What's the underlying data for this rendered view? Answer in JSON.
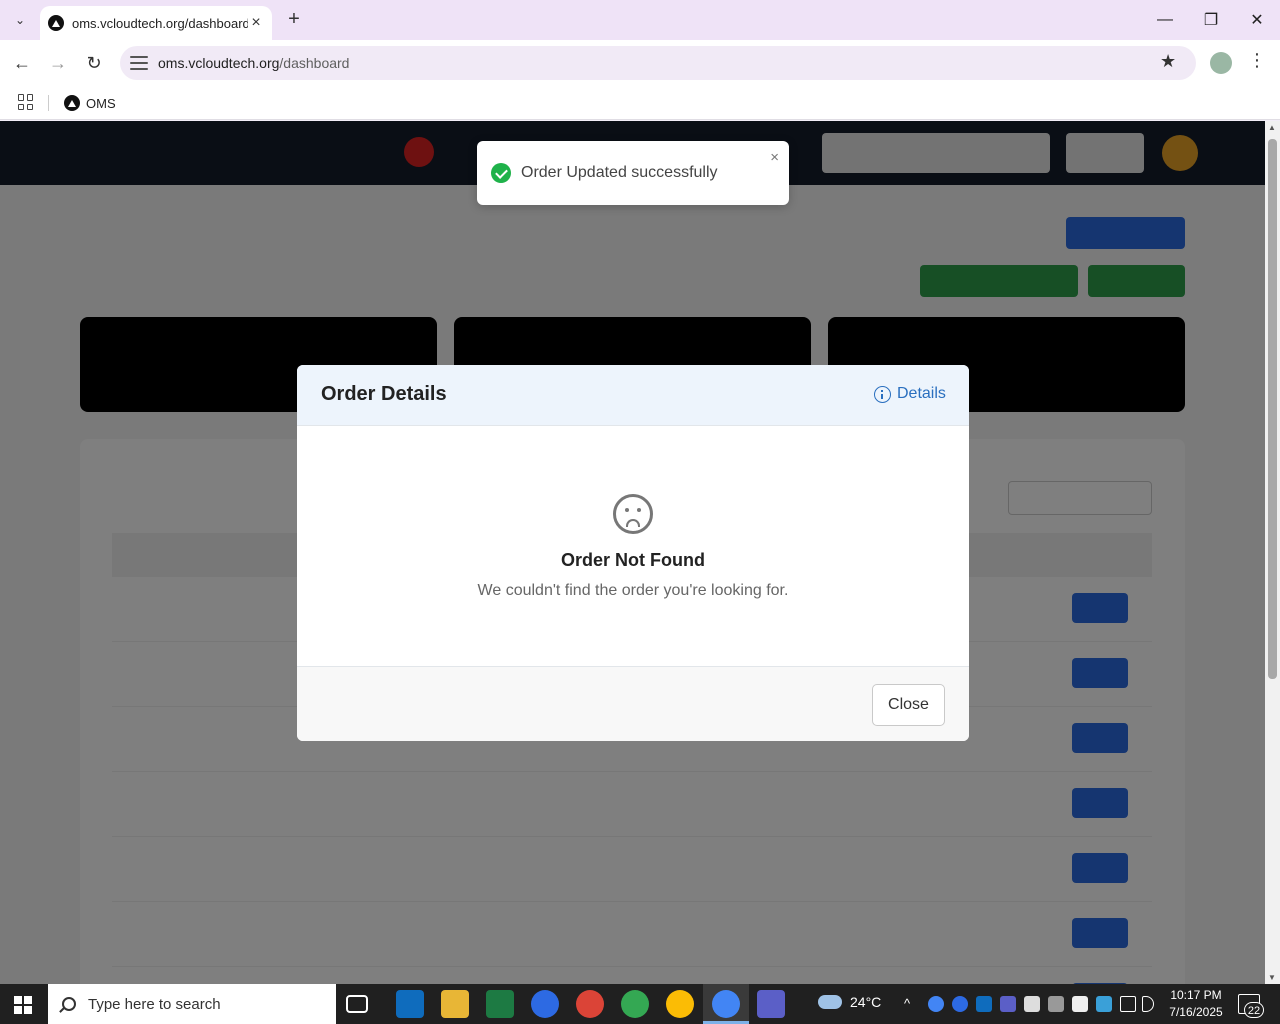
{
  "browser": {
    "tab_title": "oms.vcloudtech.org/dashboard",
    "tab_close": "×",
    "new_tab": "+",
    "url_host": "oms.vcloudtech.org",
    "url_path": "/dashboard",
    "bookmark_label": "OMS",
    "icons": {
      "back": "←",
      "forward": "→",
      "reload": "↻",
      "star": "★",
      "menu": "⋮",
      "tab_search": "⌄",
      "minimize": "—",
      "restore": "❐",
      "close": "✕"
    }
  },
  "toast": {
    "message": "Order Updated successfully",
    "close": "×",
    "color": "#1fb24a"
  },
  "modal": {
    "title": "Order Details",
    "details_link": "Details",
    "not_found_title": "Order Not Found",
    "not_found_text": "We couldn't find the order you're looking for.",
    "close_button": "Close"
  },
  "taskbar": {
    "search_placeholder": "Type here to search",
    "weather_temp": "24°C",
    "time": "10:17 PM",
    "date": "7/16/2025",
    "notification_count": "22",
    "tray_caret": "^"
  },
  "colors": {
    "accent_blue": "#2a6fbf",
    "nav_dark": "#141c2a",
    "toast_success": "#1fb24a"
  }
}
